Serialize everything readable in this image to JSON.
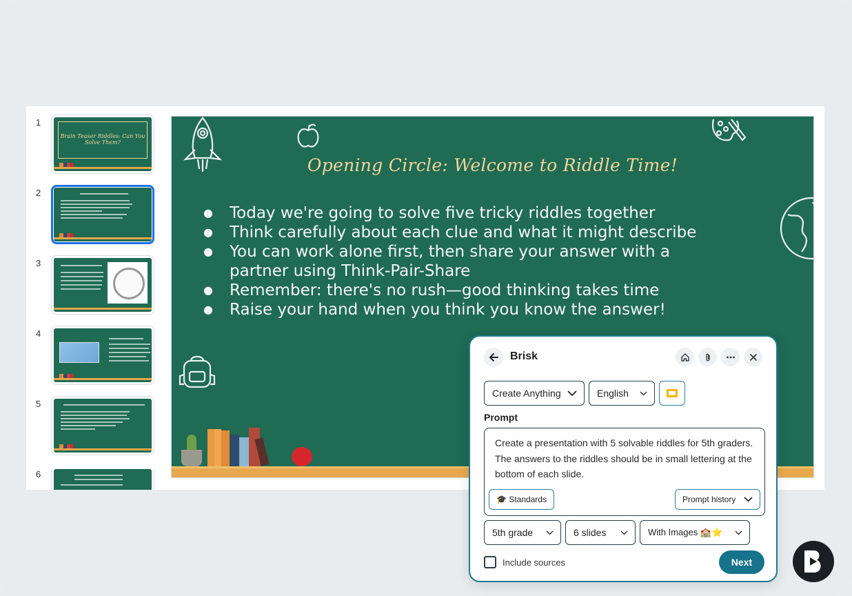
{
  "thumbnails": [
    {
      "number": "1",
      "title": "Brain Teaser Riddles: Can You Solve Them?"
    },
    {
      "number": "2"
    },
    {
      "number": "3"
    },
    {
      "number": "4"
    },
    {
      "number": "5"
    },
    {
      "number": "6"
    }
  ],
  "slide": {
    "title": "Opening Circle: Welcome to Riddle Time!",
    "bullets": [
      "Today we're going to solve five tricky riddles together",
      "Think carefully about each clue and what it might describe",
      "You can work alone first, then share your answer with a partner using Think-Pair-Share",
      "Remember: there's no rush—good thinking takes time",
      "Raise your hand when you think you know the answer!"
    ]
  },
  "brisk": {
    "title": "Brisk",
    "header_icons": [
      "home-icon",
      "paperclip-icon",
      "more-icon",
      "close-icon"
    ],
    "tool_select": "Create Anything",
    "language_select": "English",
    "prompt_label": "Prompt",
    "prompt_text": "Create a presentation with 5 solvable riddles for 5th graders. The answers to the riddles should be in small lettering at the bottom of each slide.",
    "standards_label": "🎓 Standards",
    "prompt_history_label": "Prompt history",
    "grade_select": "5th grade",
    "slides_select": "6 slides",
    "images_select": "With Images 🏫⭐",
    "include_sources_label": "Include sources",
    "next_label": "Next"
  },
  "colors": {
    "slide_bg": "#1f6b53",
    "title_color": "#f3d49a",
    "accent": "#17738c",
    "selected_thumb": "#1a73e8"
  }
}
